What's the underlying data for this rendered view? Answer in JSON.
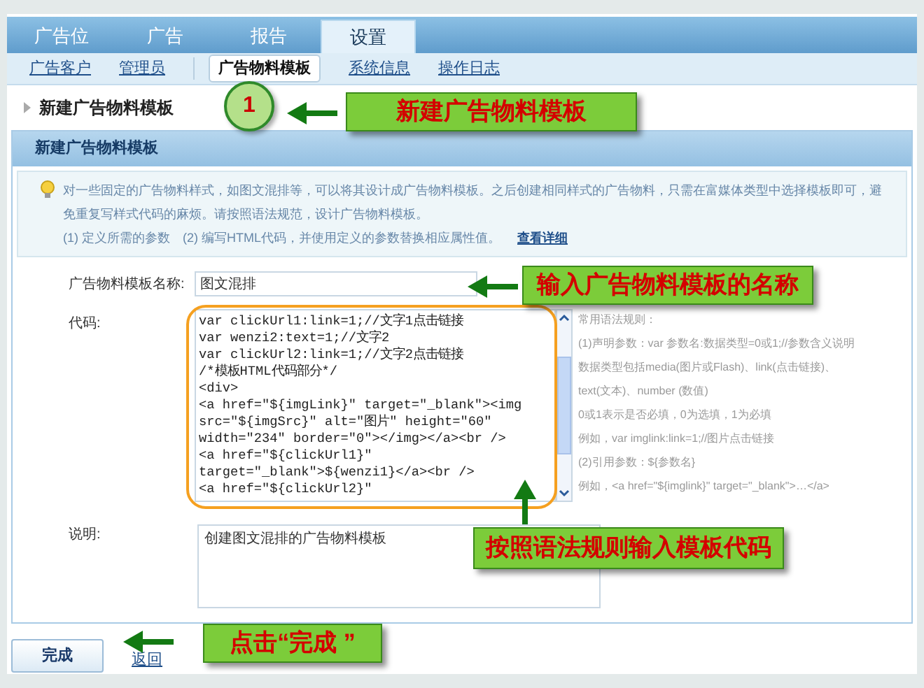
{
  "tabs": [
    {
      "label": "广告位",
      "selected": false
    },
    {
      "label": "广告",
      "selected": false
    },
    {
      "label": "报告",
      "selected": false
    },
    {
      "label": "设置",
      "selected": true
    }
  ],
  "subnav": [
    {
      "label": "广告客户",
      "selected": false
    },
    {
      "label": "管理员",
      "selected": false
    },
    {
      "label": "广告物料模板",
      "selected": true
    },
    {
      "label": "系统信息",
      "selected": false
    },
    {
      "label": "操作日志",
      "selected": false
    }
  ],
  "page_title": "新建广告物料模板",
  "panel": {
    "title": "新建广告物料模板",
    "info": {
      "paragraph": "对一些固定的广告物料样式，如图文混排等，可以将其设计成广告物料模板。之后创建相同样式的广告物料，只需在富媒体类型中选择模板即可，避免重复写样式代码的麻烦。请按照语法规范，设计广告物料模板。",
      "steps": "(1) 定义所需的参数　(2) 编写HTML代码，并使用定义的参数替换相应属性值。",
      "link": "查看详细"
    },
    "name_field": {
      "label": "广告物料模板名称:",
      "value": "图文混排"
    },
    "code_field": {
      "label": "代码:",
      "lines": [
        "var clickUrl1:link=1;//文字1点击链接",
        "var wenzi2:text=1;//文字2",
        "var clickUrl2:link=1;//文字2点击链接",
        "/*模板HTML代码部分*/",
        "<div>",
        "<a href=\"${imgLink}\" target=\"_blank\"><img",
        "src=\"${imgSrc}\" alt=\"图片\" height=\"60\"",
        "width=\"234\" border=\"0\"></img></a><br />",
        "<a href=\"${clickUrl1}\"",
        "target=\"_blank\">${wenzi1}</a><br />",
        "<a href=\"${clickUrl2}\""
      ]
    },
    "rules": [
      "常用语法规则：",
      "(1)声明参数：var 参数名:数据类型=0或1;//参数含义说明",
      "数据类型包括media(图片或Flash)、link(点击链接)、",
      "text(文本)、number (数值)",
      "0或1表示是否必填，0为选填，1为必填",
      "例如，var imglink:link=1;//图片点击链接",
      "(2)引用参数：${参数名}",
      "例如，<a href=\"${imglink}\" target=\"_blank\">…</a>"
    ],
    "description_field": {
      "label": "说明:",
      "value": "创建图文混排的广告物料模板"
    }
  },
  "buttons": [
    {
      "label": "完成",
      "kind": "button"
    },
    {
      "label": "返回",
      "kind": "link"
    }
  ],
  "callouts": {
    "step_number": "1",
    "step_title": "新建广告物料模板",
    "name_hint": "输入广告物料模板的名称",
    "code_hint": "按照语法规则输入模板代码",
    "finish_hint": "点击“完成 ”"
  }
}
